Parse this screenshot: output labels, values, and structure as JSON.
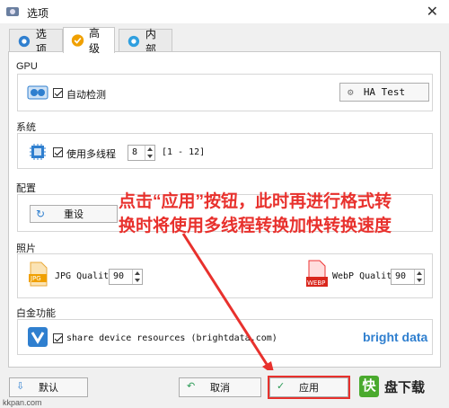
{
  "window": {
    "title": "选项"
  },
  "tabs": [
    {
      "label": "选项"
    },
    {
      "label": "高级"
    },
    {
      "label": "内部"
    }
  ],
  "gpu": {
    "section": "GPU",
    "auto_detect": "自动检测",
    "test_button": "HA Test"
  },
  "system": {
    "section": "系统",
    "multithread": "使用多线程",
    "threads": "8",
    "range": "[1 - 12]"
  },
  "config": {
    "section": "配置",
    "reset_button": "重设"
  },
  "photo": {
    "section": "照片",
    "jpg_label": "JPG Quality",
    "jpg_value": "90",
    "jpg_icon_text": "JPG",
    "webp_label": "WebP Quality",
    "webp_value": "90",
    "webp_icon_text": "WEBP"
  },
  "platinum": {
    "section": "白金功能",
    "share": "share device resources (brightdata.com)",
    "brand": "bright data"
  },
  "annotation": {
    "line1": "点击“应用”按钮，此时再进行格式转",
    "line2": "换时将使用多线程转换加快转换速度"
  },
  "buttons": {
    "default": "默认",
    "cancel": "取消",
    "apply": "应用"
  },
  "watermark": {
    "logo": "快",
    "name": "盘下载",
    "url": "kkpan.com"
  },
  "colors": {
    "accent_blue": "#2f7fcf",
    "annotation_red": "#e8312d",
    "orange": "#f0a000"
  }
}
